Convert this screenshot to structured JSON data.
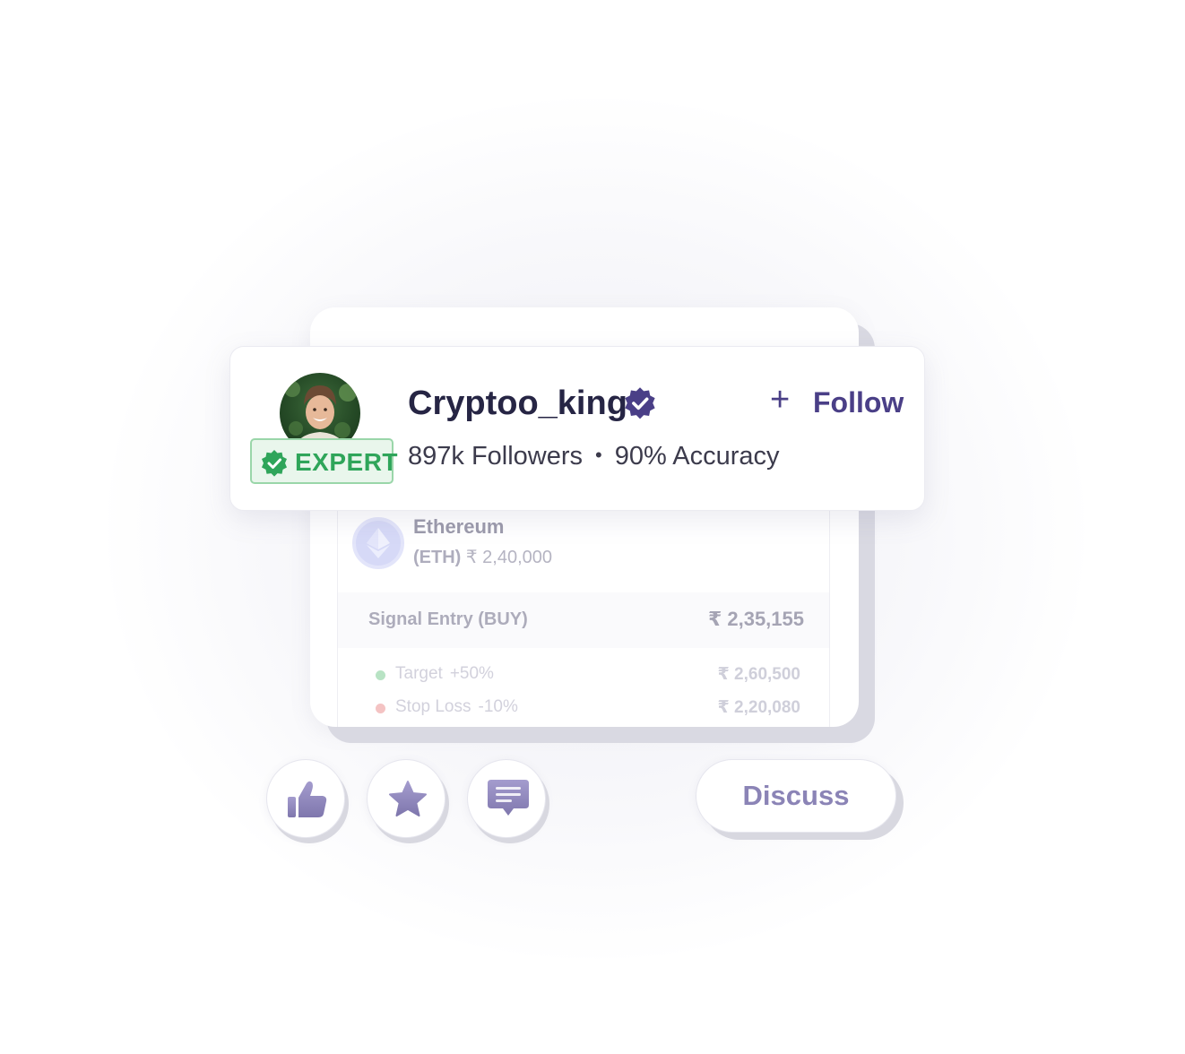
{
  "profile": {
    "username": "Cryptoo_king",
    "badge": "EXPERT",
    "followers": "897k Followers",
    "separator": "•",
    "accuracy": "90% Accuracy",
    "follow_icon": "+",
    "follow_label": "Follow"
  },
  "signal": {
    "coin_name": "Ethereum",
    "coin_symbol": "(ETH)",
    "coin_price": "₹ 2,40,000",
    "entry_label": "Signal Entry (BUY)",
    "entry_value": "₹ 2,35,155",
    "target_label": "Target",
    "target_pct": "+50%",
    "target_value": "₹ 2,60,500",
    "stop_label": "Stop Loss",
    "stop_pct": "-10%",
    "stop_value": "₹ 2,20,080"
  },
  "actions": {
    "like_icon": "thumbs-up-icon",
    "star_icon": "star-icon",
    "comment_icon": "comment-icon",
    "discuss_label": "Discuss"
  },
  "colors": {
    "accent": "#4a3f87",
    "expert_green": "#2fa55a",
    "target_dot": "#b8e3c4",
    "stop_dot": "#f4c3c3",
    "icon_lavender": "#8e86b8"
  }
}
